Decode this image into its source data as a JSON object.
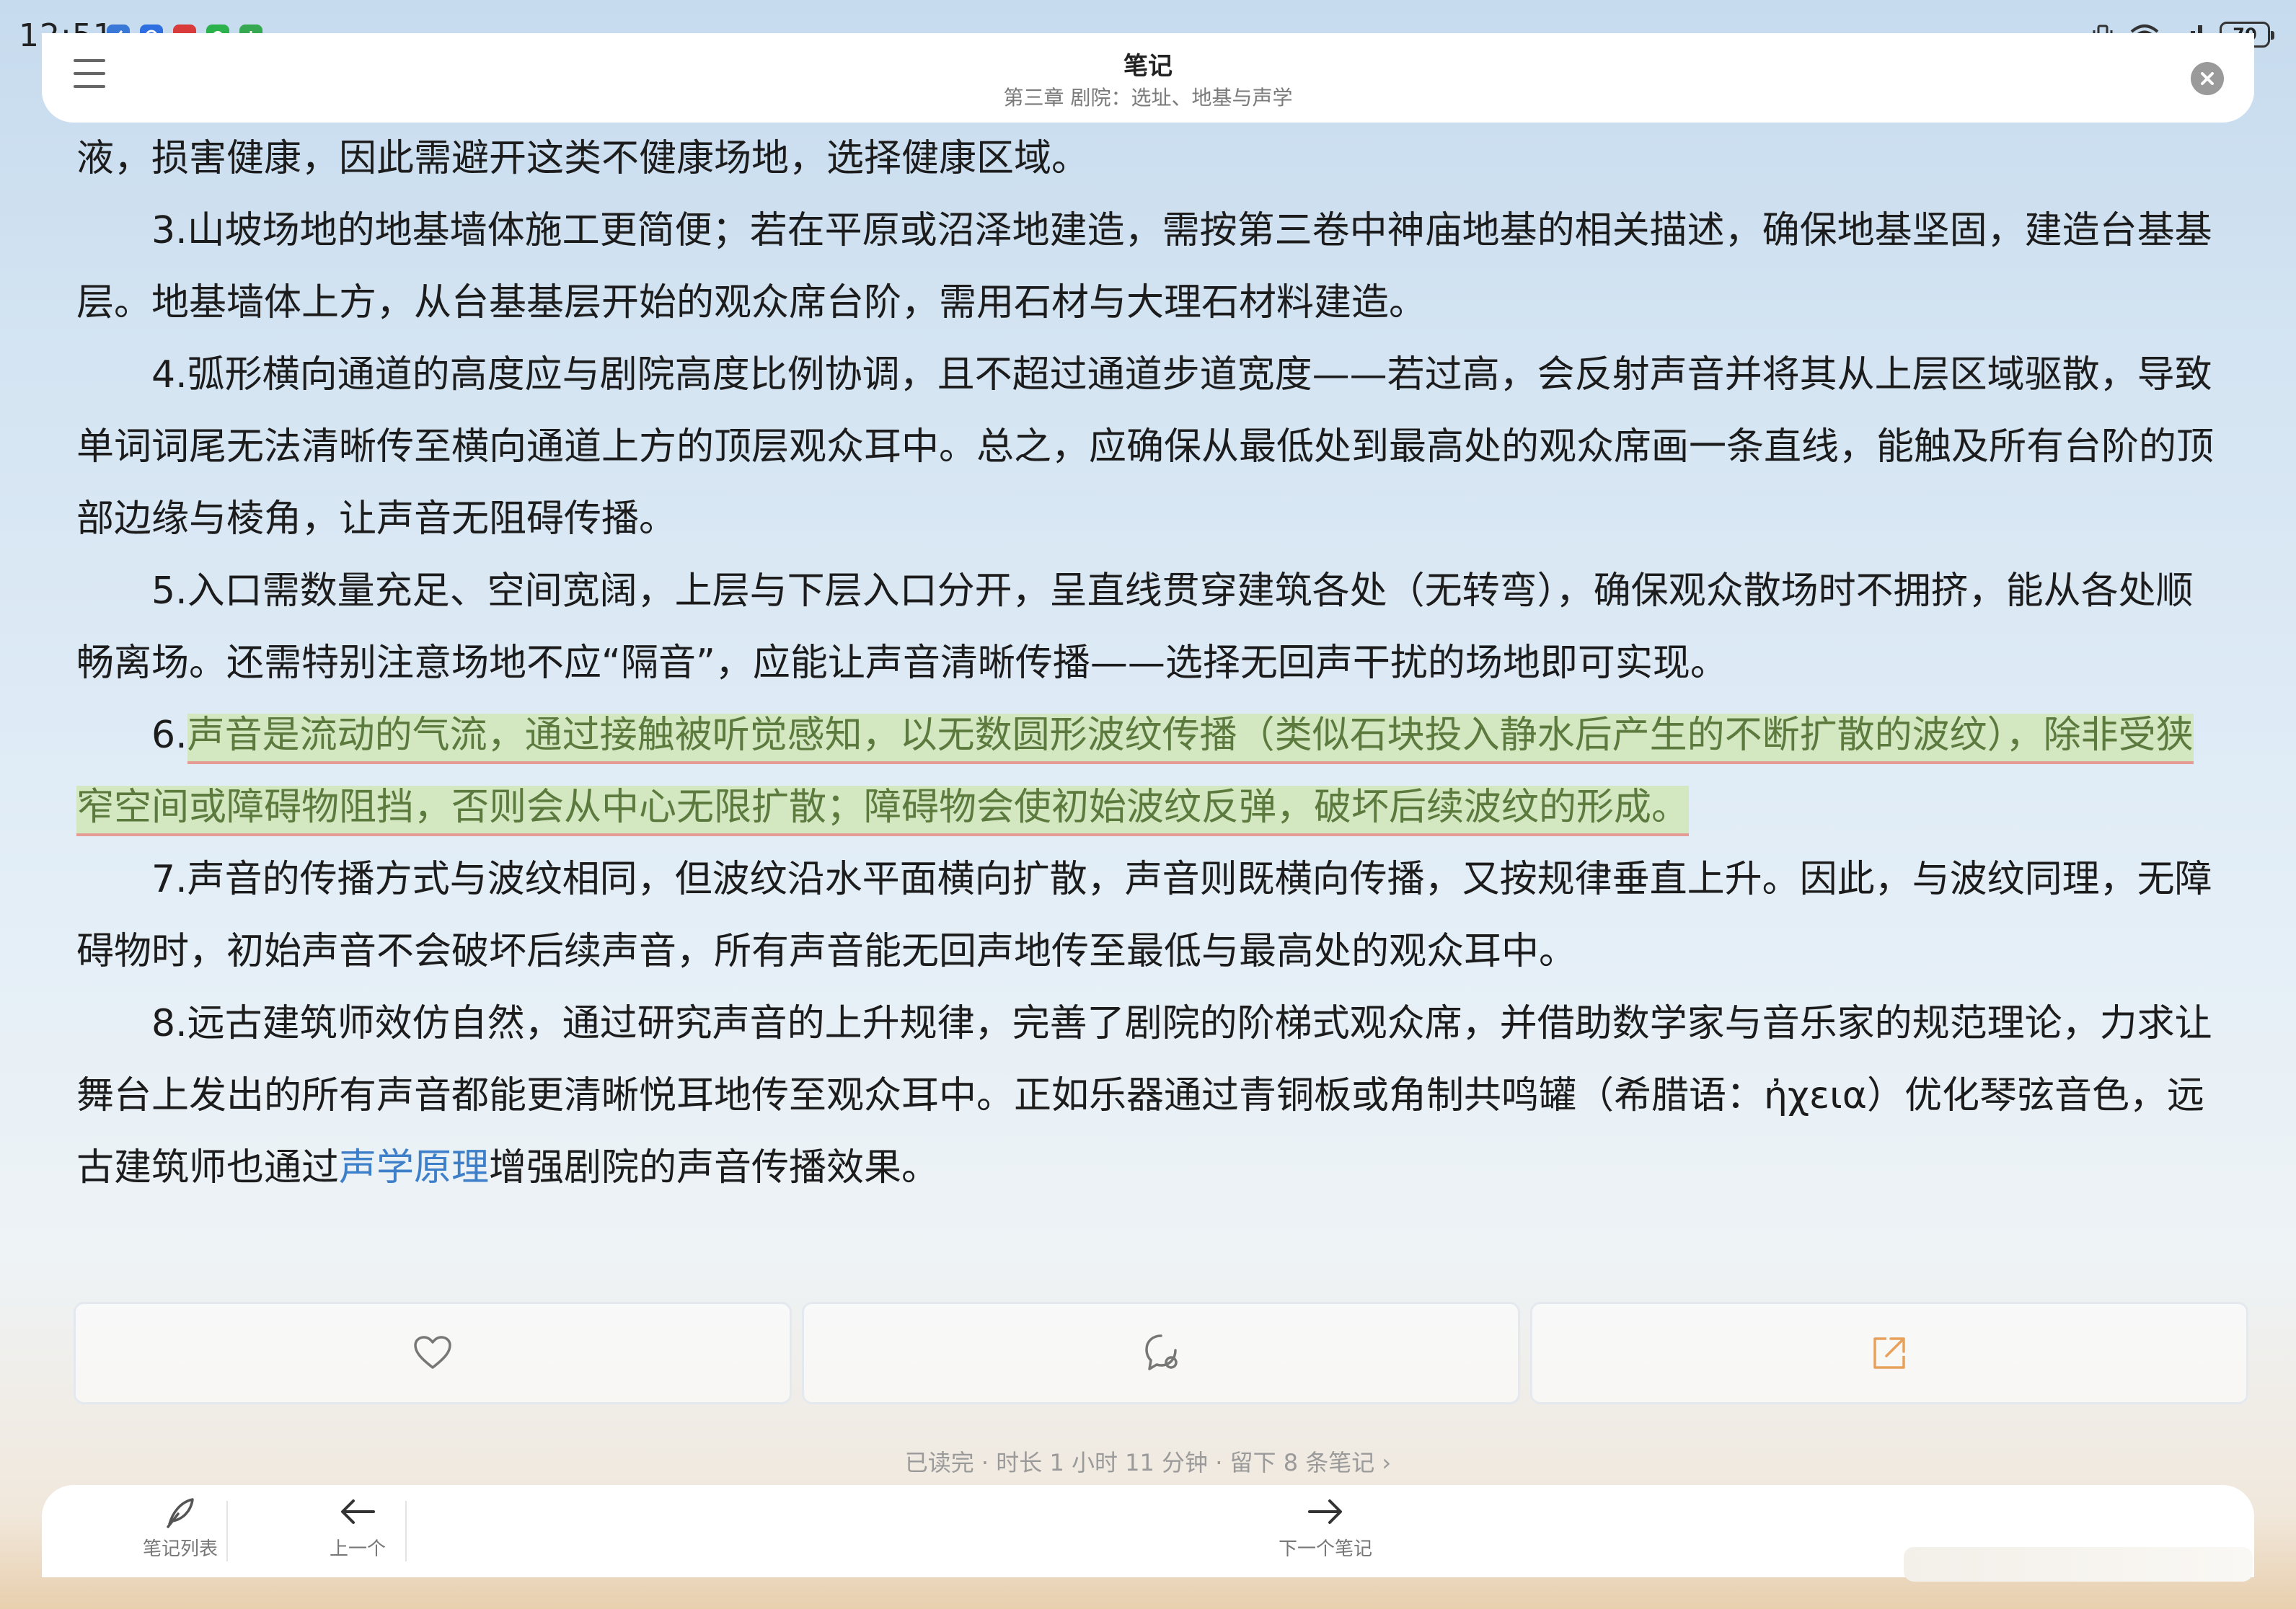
{
  "status_bar": {
    "time": "12:51",
    "battery": "70",
    "notification_icons": [
      "feather-icon",
      "browser-icon",
      "weibo-icon",
      "wechat-icon",
      "download-icon"
    ],
    "more": "···"
  },
  "header": {
    "title": "笔记",
    "subtitle": "第三章 剧院：选址、地基与声学"
  },
  "article": {
    "p0": "液，损害健康，因此需避开这类不健康场地，选择健康区域。",
    "p1": "3.山坡场地的地基墙体施工更简便；若在平原或沼泽地建造，需按第三卷中神庙地基的相关描述，确保地基坚固，建造台基基层。地基墙体上方，从台基基层开始的观众席台阶，需用石材与大理石材料建造。",
    "p2": "4.弧形横向通道的高度应与剧院高度比例协调，且不超过通道步道宽度——若过高，会反射声音并将其从上层区域驱散，导致单词词尾无法清晰传至横向通道上方的顶层观众耳中。总之，应确保从最低处到最高处的观众席画一条直线，能触及所有台阶的顶部边缘与棱角，让声音无阻碍传播。",
    "p3": "5.入口需数量充足、空间宽阔，上层与下层入口分开，呈直线贯穿建筑各处（无转弯），确保观众散场时不拥挤，能从各处顺畅离场。还需特别注意场地不应“隔音”，应能让声音清晰传播——选择无回声干扰的场地即可实现。",
    "p4_prefix": "6.",
    "p4_highlight": "声音是流动的气流，通过接触被听觉感知，以无数圆形波纹传播（类似石块投入静水后产生的不断扩散的波纹），除非受狭窄空间或障碍物阻挡，否则会从中心无限扩散；障碍物会使初始波纹反弹，破坏后续波纹的形成。",
    "p5": "7.声音的传播方式与波纹相同，但波纹沿水平面横向扩散，声音则既横向传播，又按规律垂直上升。因此，与波纹同理，无障碍物时，初始声音不会破坏后续声音，所有声音能无回声地传至最低与最高处的观众耳中。",
    "p6_before": "8.远古建筑师效仿自然，通过研究声音的上升规律，完善了剧院的阶梯式观众席，并借助数学家与音乐家的规范理论，力求让舞台上发出的所有声音都能更清晰悦耳地传至观众耳中。正如乐器通过青铜板或角制共鸣罐（希腊语：ἠχεια）优化琴弦音色，远古建筑师也通过",
    "p6_link": "声学原理",
    "p6_after": "增强剧院的声音传播效果。"
  },
  "actions": {
    "like_icon": "heart-icon",
    "comment_icon": "comment-icon",
    "share_icon": "share-icon"
  },
  "reading_info": "已读完 · 时长 1 小时 11 分钟 · 留下 8 条笔记 ›",
  "bottom_nav": {
    "notes_list": "笔记列表",
    "previous": "上一个",
    "next_note": "下一个笔记"
  },
  "colors": {
    "highlight_bg": "#d3e7c1",
    "highlight_text": "#5c7a3e",
    "highlight_underline": "#e59c94",
    "link": "#3d7fc9"
  }
}
